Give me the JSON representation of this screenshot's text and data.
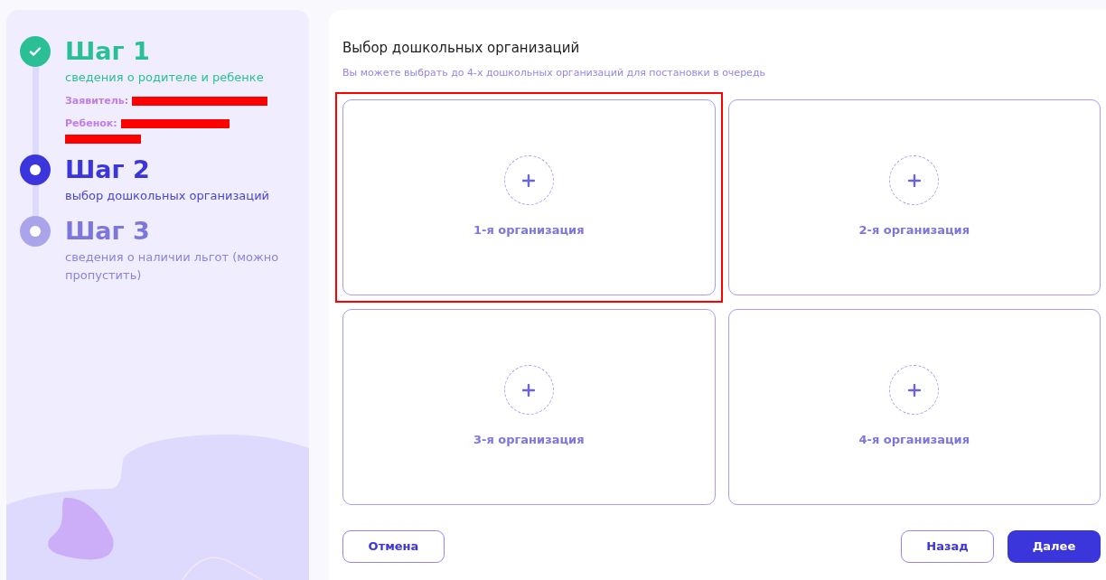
{
  "steps": [
    {
      "kind": "done",
      "title": "Шаг 1",
      "subtitle": "сведения о родителе и ребенке",
      "details": [
        {
          "label": "Заявитель:",
          "redacted": true
        },
        {
          "label": "Ребенок:",
          "redacted": true
        }
      ]
    },
    {
      "kind": "current",
      "title": "Шаг 2",
      "subtitle": "выбор дошкольных организаций"
    },
    {
      "kind": "upcoming",
      "title": "Шаг 3",
      "subtitle": "сведения о наличии льгот (можно пропустить)"
    }
  ],
  "section": {
    "title": "Выбор дошкольных организаций",
    "hint": "Вы можете выбрать до 4-х дошкольных организаций для постановки в очередь"
  },
  "organizations": [
    {
      "label": "1-я организация",
      "highlighted": true
    },
    {
      "label": "2-я организация",
      "highlighted": false
    },
    {
      "label": "3-я организация",
      "highlighted": false
    },
    {
      "label": "4-я организация",
      "highlighted": false
    }
  ],
  "buttons": {
    "cancel": "Отмена",
    "back": "Назад",
    "next": "Далее"
  }
}
